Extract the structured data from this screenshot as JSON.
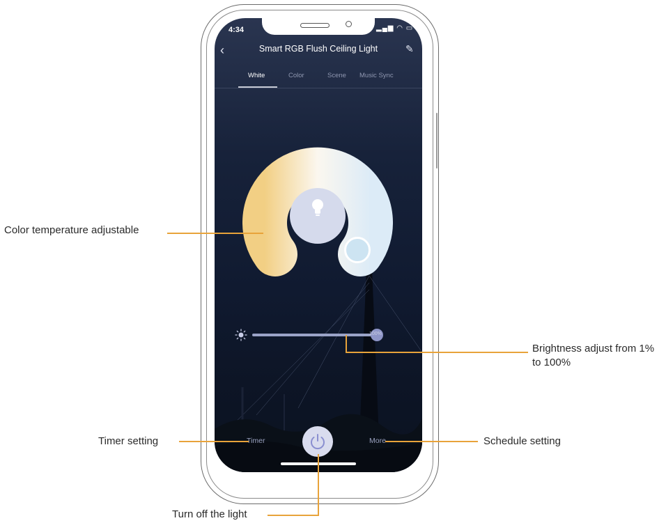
{
  "status_bar": {
    "time": "4:34",
    "icons": "▂▄▆ ◠ ▭"
  },
  "header": {
    "back_icon": "‹",
    "title": "Smart RGB Flush Ceiling Light",
    "edit_icon": "✎"
  },
  "tabs": [
    {
      "label": "White",
      "active": true
    },
    {
      "label": "Color",
      "active": false
    },
    {
      "label": "Scene",
      "active": false
    },
    {
      "label": "Music Sync",
      "active": false
    }
  ],
  "color_wheel": {
    "warm_color": "#f2cf84",
    "cool_color": "#dcebf7",
    "center_color": "#d5daec"
  },
  "brightness": {
    "value_label": "100%",
    "level_percent": 100
  },
  "bottom_bar": {
    "timer_label": "Timer",
    "more_label": "More",
    "power_icon": "power-icon"
  },
  "callouts": {
    "color_temperature": "Color temperature adjustable",
    "brightness": "Brightness adjust from 1% to 100%",
    "timer": "Timer setting",
    "schedule": "Schedule setting",
    "power": "Turn off the light"
  },
  "accent_color": "#e8a33a"
}
